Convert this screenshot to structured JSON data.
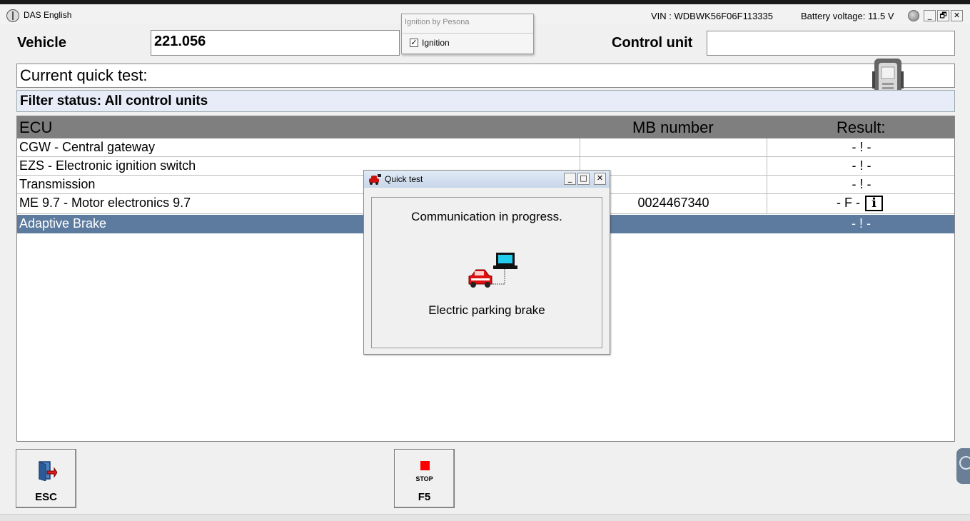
{
  "window": {
    "title": "DAS English",
    "vin": "VIN : WDBWK56F06F113335",
    "battery": "Battery voltage: 11.5 V",
    "buttons": {
      "minimize": "_",
      "restore": "🗗",
      "close": "✕"
    }
  },
  "ignition_popup": {
    "title": "Ignition by Pesona",
    "checkbox_label": "Ignition",
    "checked": true
  },
  "vehicle": {
    "label": "Vehicle",
    "value": "221.056"
  },
  "control_unit": {
    "label": "Control unit",
    "value": ""
  },
  "quick_test": {
    "label": "Current quick test:"
  },
  "filter": {
    "status": "Filter status: All control units"
  },
  "table": {
    "columns": {
      "ecu": "ECU",
      "mb": "MB number",
      "result": "Result:"
    },
    "rows": [
      {
        "ecu": "CGW - Central gateway",
        "mb": "",
        "result": "- ! -"
      },
      {
        "ecu": "EZS - Electronic ignition switch",
        "mb": "",
        "result": "- ! -"
      },
      {
        "ecu": "Transmission",
        "mb": "",
        "result": "- ! -"
      },
      {
        "ecu": "ME 9.7 - Motor electronics 9.7",
        "mb": "0024467340",
        "result": "- F -"
      },
      {
        "ecu": "Adaptive Brake",
        "mb": "",
        "result": "- ! -"
      }
    ],
    "info_icon": "i"
  },
  "dialog": {
    "title": "Quick test",
    "message": "Communication in progress.",
    "subtext": "Electric parking brake",
    "buttons": {
      "minimize": "_",
      "maximize": "□",
      "close": "✕"
    }
  },
  "function_buttons": {
    "esc": {
      "label": "ESC"
    },
    "stop": {
      "label": "F5",
      "icon_text": "STOP"
    }
  },
  "colors": {
    "selected_row": "#5c7b9f",
    "table_header": "#7f7f7f",
    "filter_bar": "#e8ecf8",
    "stop_red": "#ff0000"
  }
}
